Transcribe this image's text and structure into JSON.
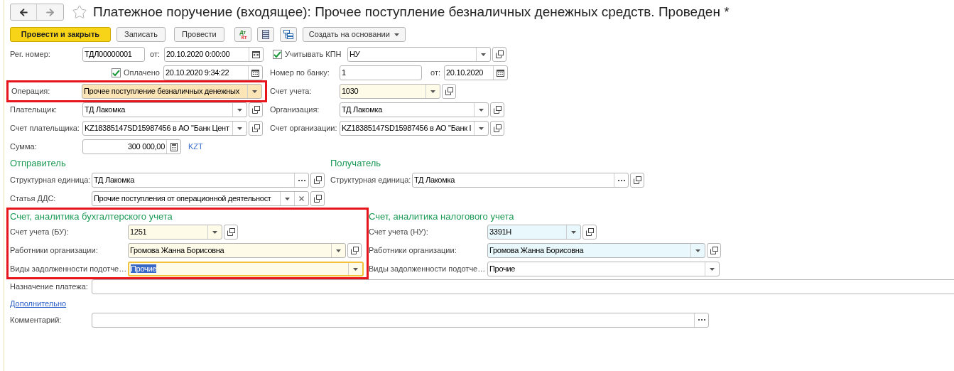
{
  "title": "Платежное поручение (входящее): Прочее поступление безналичных денежных средств. Проведен *",
  "favorite": false,
  "toolbar": [
    {
      "kind": "primary",
      "label": "Провести и закрыть"
    },
    {
      "kind": "button",
      "label": "Записать"
    },
    {
      "kind": "button",
      "label": "Провести"
    },
    {
      "kind": "dtkt",
      "top": "Дт",
      "bottom": "Кт"
    },
    {
      "kind": "list"
    },
    {
      "kind": "structure"
    },
    {
      "kind": "menu",
      "label": "Создать на основании"
    }
  ],
  "header": {
    "reg_number": {
      "label": "Рег. номер:",
      "value": "ТДЛ00000001"
    },
    "date": {
      "label": "от:",
      "value": "20.10.2020  0:00:00",
      "kind": "date"
    },
    "kpn": {
      "label": "Учитывать КПН",
      "checked": true,
      "value": "НУ",
      "kind": "combo"
    },
    "paid": {
      "label": "Оплачено",
      "checked": true,
      "value": "20.10.2020  9:34:22",
      "kind": "date"
    },
    "bank_number": {
      "label": "Номер по банку:",
      "value": "1"
    },
    "bank_date": {
      "label": "от:",
      "value": "20.10.2020",
      "kind": "date"
    },
    "operation": {
      "label": "Операция:",
      "value": "Прочее поступление безналичных денежных",
      "color": "#fbe4b6",
      "annotated": true,
      "kind": "choice"
    },
    "account": {
      "label": "Счет учета:",
      "value": "1030",
      "color": "#fefbe8",
      "kind": "combo"
    },
    "payer": {
      "label": "Плательщик:",
      "value": "ТД Лакомка",
      "kind": "combo"
    },
    "organization": {
      "label": "Организация:",
      "value": "ТД Лакомка",
      "kind": "combo"
    },
    "payer_account": {
      "label": "Счет плательщика:",
      "value": "KZ18385147SD15987456 в АО \"Банк Цент",
      "kind": "combo"
    },
    "org_account": {
      "label": "Счет организации:",
      "value": "KZ18385147SD15987456 в АО \"Банк I",
      "kind": "combo"
    },
    "amount": {
      "label": "Сумма:",
      "value": "300 000,00",
      "currency": "KZT",
      "kind": "number"
    }
  },
  "sender": {
    "title": "Отправитель",
    "unit": {
      "label": "Структурная единица:",
      "value": "ТД Лакомка",
      "kind": "reference"
    },
    "dds": {
      "label": "Статья ДДС:",
      "value": "Прочие поступления от операционной деятельност",
      "kind": "clearable"
    }
  },
  "recipient": {
    "title": "Получатель",
    "unit": {
      "label": "Структурная единица:",
      "value": "ТД Лакомка",
      "kind": "reference"
    }
  },
  "accounting": {
    "title": "Счет, аналитика бухгалтерского учета",
    "annotated": true,
    "rows": [
      {
        "label": "Счет учета (БУ):",
        "value": "1251",
        "color": "#fefbe8",
        "focused": false,
        "kind": "combo"
      },
      {
        "label": "Работники организации:",
        "value": "Громова Жанна Борисовна",
        "color": "#fefbe8",
        "focused": false,
        "kind": "combo"
      },
      {
        "label": "Виды задолженности подотче…",
        "value": "Прочие",
        "color": "#fefbe8",
        "focused": true,
        "kind": "choice"
      }
    ]
  },
  "tax": {
    "title": "Счет, аналитика налогового учета",
    "rows": [
      {
        "label": "Счет учета (НУ):",
        "value": "3391Н",
        "color": "#e9f8fc",
        "focused": false,
        "kind": "combo"
      },
      {
        "label": "Работники организации:",
        "value": "Громова Жанна Борисовна",
        "color": "#e9f8fc",
        "focused": false,
        "kind": "combo"
      },
      {
        "label": "Виды задолженности подотче…",
        "value": "Прочие",
        "color": "#ffffff",
        "focused": false,
        "kind": "choice"
      }
    ]
  },
  "purpose": {
    "label": "Назначение платежа:"
  },
  "more_link": "Дополнительно",
  "comment": {
    "label": "Комментарий:",
    "kind": "memo"
  }
}
